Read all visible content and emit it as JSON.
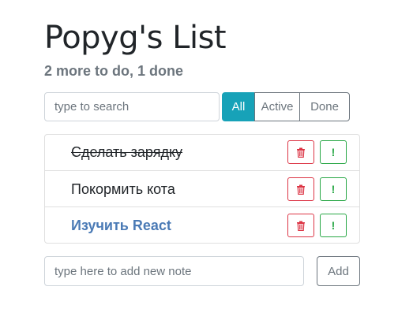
{
  "header": {
    "title": "Popyg's List",
    "subtitle": "2 more to do, 1 done"
  },
  "search": {
    "placeholder": "type to search",
    "value": ""
  },
  "filters": [
    {
      "label": "All",
      "active": true
    },
    {
      "label": "Active",
      "active": false
    },
    {
      "label": "Done",
      "active": false
    }
  ],
  "todos": [
    {
      "label": "Сделать зарядку",
      "done": true,
      "important": false
    },
    {
      "label": "Покормить кота",
      "done": false,
      "important": false
    },
    {
      "label": "Изучить React",
      "done": false,
      "important": true
    }
  ],
  "item_buttons": {
    "delete_icon": "trash-icon",
    "important_icon": "exclamation-icon",
    "important_glyph": "!"
  },
  "add_form": {
    "placeholder": "type here to add new note",
    "value": "",
    "button_label": "Add"
  },
  "colors": {
    "accent": "#17a2b8",
    "danger": "#dc3545",
    "success": "#28a745",
    "important_text": "#4a7ab5",
    "muted": "#6c757d"
  }
}
